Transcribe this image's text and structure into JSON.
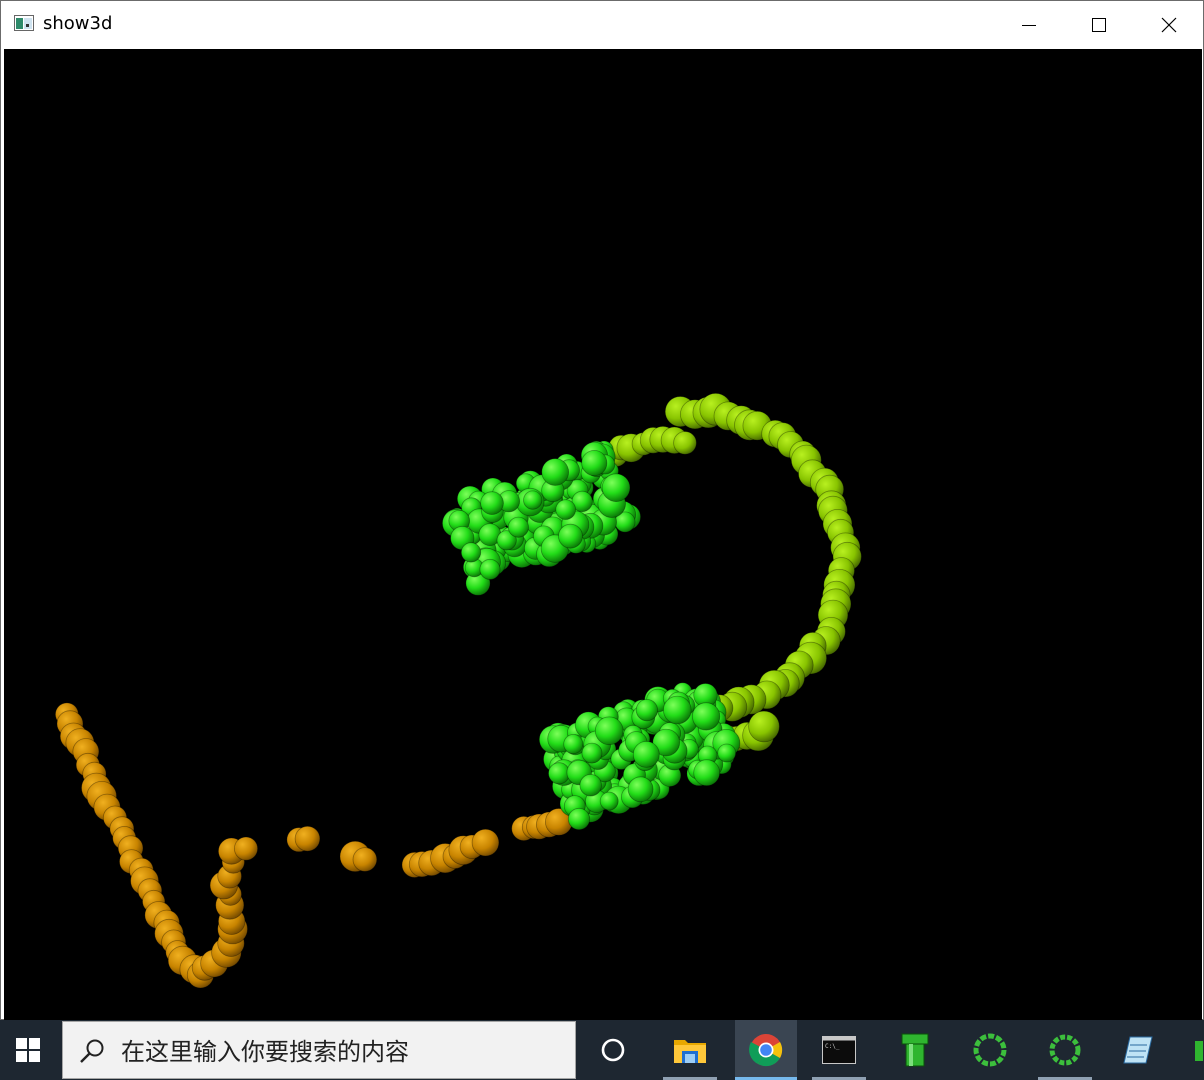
{
  "window": {
    "title": "show3d",
    "controls": {
      "minimize": "minimize-icon",
      "maximize": "maximize-icon",
      "close": "close-icon"
    }
  },
  "scene": {
    "background": "#000000",
    "colors": {
      "orange_chain": "#c88400",
      "headband": "#8fcc00",
      "ear_cups": "#1fd81f"
    }
  },
  "taskbar": {
    "search_placeholder": "在这里输入你要搜索的内容",
    "items": [
      {
        "icon": "cortana-circle-icon"
      },
      {
        "icon": "file-explorer-icon"
      },
      {
        "icon": "chrome-icon"
      },
      {
        "icon": "command-prompt-icon"
      },
      {
        "icon": "green-pipe-icon"
      },
      {
        "icon": "loading-ring-icon"
      },
      {
        "icon": "loading-ring-icon"
      },
      {
        "icon": "notepad-icon"
      }
    ]
  }
}
